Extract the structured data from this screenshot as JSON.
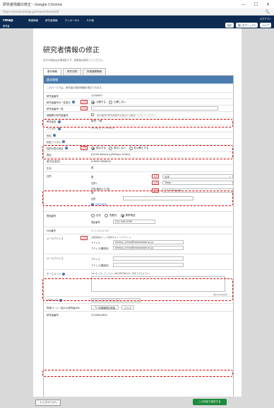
{
  "window": {
    "title": "研究者情報の修正 - Google Chrome",
    "min": "—",
    "max": "☐",
    "close": "✕"
  },
  "address": {
    "url": "https://researchmap.jp/researchers/edit",
    "zoom": "🔍"
  },
  "nav": {
    "logo": "rmap",
    "menu": [
      "業績情報",
      "研究者情報",
      "マイポータル",
      "その他"
    ],
    "sub": "研究者",
    "user_link": "ログアウト",
    "buttons": [
      "設定",
      "使い方マニュアル",
      "ヘルプ"
    ]
  },
  "page": {
    "title": "研究者情報の修正",
    "note": "太字の項目は必須項目です。変更後は保存してください。"
  },
  "tabs": [
    "基本情報",
    "研究分野",
    "所属機関情報"
  ],
  "panel": {
    "heading": "基本情報",
    "required_note": "このページでは、研究者の基本情報を修正できます。"
  },
  "labels": {
    "researcher_id": "研究者番号",
    "kaken_link": "研究者番号の一覧表示",
    "kaken_no": "研究者番号一覧",
    "other": "他機関の研究者番号",
    "name": "研究者名",
    "kana": "フリガナ",
    "alias": "別名",
    "alias_kana": "別名フリガナ",
    "gender": "性別の表示設定",
    "display_name": "表記",
    "english_name": "英字名(姓名)",
    "birth": "生年",
    "address": "住所",
    "phone": "電話番号",
    "fax": "FAX番号",
    "email": "メールアドレス",
    "email2": "メールアドレス",
    "homepage": "ホームページ",
    "orcid": "ORCID ID",
    "affil_link": "所属ページ・個人の研究者URL",
    "researcher_no": "研究者番号"
  },
  "values": {
    "researcher_id_val": "1234567",
    "kaken_opt_yes": "公開する",
    "kaken_opt_no": "公開しない",
    "other_chk": "他の機関の研究者番号を追加する場合に入力してください。",
    "name_val": "研究 一郎",
    "kana_val": "ケンキュウ イチロウ",
    "gender_opt1": "表示する",
    "gender_opt2": "表示しない",
    "gender_opt3": "非公開とする",
    "display_val": "[Ichiro Kenkyu] [Kenkyu Ichiro]",
    "english_val": "ICHIRO KENKYU",
    "birth_val": "男",
    "addr_labels": [
      "国",
      "住所1",
      "住所(番地以下)(英語)",
      "住所"
    ],
    "addr_vals": [
      "日本",
      "Tokyo",
      "1-2-3 Chiyoda",
      ""
    ],
    "addr_link": "住所を追加",
    "phone_opts": [
      "自宅",
      "勤務先",
      "携帯電話"
    ],
    "phone_label": "電話番号",
    "phone_val": "012-345-6789",
    "fax_val": "012-345-6780",
    "email_note": "主要連絡先として使用するメールアドレス",
    "email_label1": "アドレス",
    "email_val1": "kenkyu_ichiro@realsample.ac.jp",
    "email_label2": "アドレス(確認用)",
    "email_val2": "kenkyu_ichiro@realsample.ac.jp",
    "email2_label1": "アドレス",
    "email2_label2": "アドレス(確認用)",
    "homepage_note": "URLを入力してください(他の研究者の方と区別できるように)",
    "homepage_count": "残り1000文字",
    "orcid_val": "0000-0000-0000-0000",
    "affil_btn": "所属機関を検索",
    "affil_btn2": "クリア",
    "researcher_no_val": "1234567890"
  },
  "footer": {
    "back": "トップページへ",
    "save": "この内容で保存する"
  },
  "colors": {
    "nav": "#0d2b52",
    "panel_head": "#4a7bb0",
    "highlight": "#dd0000",
    "save": "#1e8a3c"
  }
}
